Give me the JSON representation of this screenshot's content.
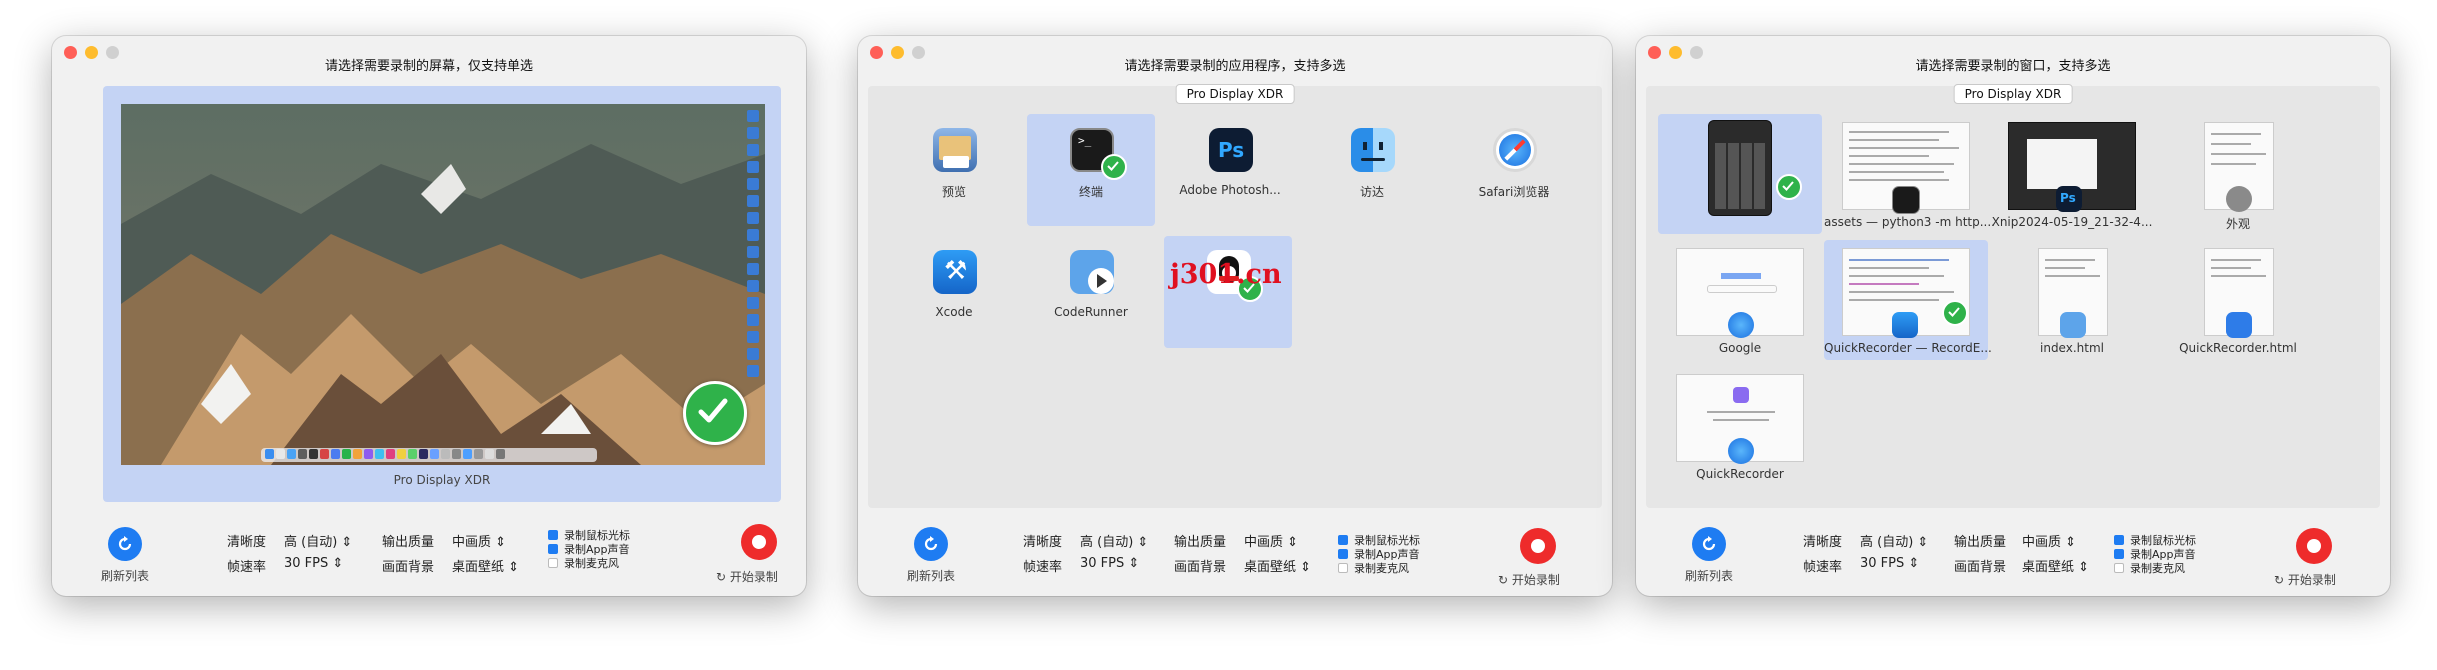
{
  "windows": [
    {
      "title": "请选择需要录制的屏幕，仅支持单选",
      "screen_label": "Pro Display XDR",
      "bottom": {
        "refresh_label": "刷新列表",
        "clarity_label": "清晰度",
        "clarity_value": "高 (自动)",
        "fps_label": "帧速率",
        "fps_value": "30 FPS",
        "quality_label": "输出质量",
        "quality_value": "中画质",
        "bg_label": "画面背景",
        "bg_value": "桌面壁纸",
        "cb1": "录制鼠标光标",
        "cb2": "录制App声音",
        "cb3": "录制麦克风",
        "record_label": "开始录制"
      }
    },
    {
      "title": "请选择需要录制的应用程序，支持多选",
      "display_chip": "Pro Display XDR",
      "apps": [
        {
          "label": "预览",
          "selected": false
        },
        {
          "label": "终端",
          "selected": true
        },
        {
          "label": "Adobe Photosh...",
          "selected": false
        },
        {
          "label": "访达",
          "selected": false
        },
        {
          "label": "Safari浏览器",
          "selected": false
        },
        {
          "label": "Xcode",
          "selected": false
        },
        {
          "label": "CodeRunner",
          "selected": false
        },
        {
          "label": "",
          "selected": true
        }
      ],
      "bottom": {
        "refresh_label": "刷新列表",
        "clarity_label": "清晰度",
        "clarity_value": "高 (自动)",
        "fps_label": "帧速率",
        "fps_value": "30 FPS",
        "quality_label": "输出质量",
        "quality_value": "中画质",
        "bg_label": "画面背景",
        "bg_value": "桌面壁纸",
        "cb1": "录制鼠标光标",
        "cb2": "录制App声音",
        "cb3": "录制麦克风",
        "record_label": "开始录制"
      }
    },
    {
      "title": "请选择需要录制的窗口，支持多选",
      "display_chip": "Pro Display XDR",
      "wins": [
        {
          "label": "",
          "selected": true
        },
        {
          "label": "assets — python3 -m http....",
          "selected": false
        },
        {
          "label": "Xnip2024-05-19_21-32-4...",
          "selected": false
        },
        {
          "label": "外观",
          "selected": false
        },
        {
          "label": "Google",
          "selected": false
        },
        {
          "label": "QuickRecorder — RecordE...",
          "selected": true
        },
        {
          "label": "index.html",
          "selected": false
        },
        {
          "label": "QuickRecorder.html",
          "selected": false
        },
        {
          "label": "QuickRecorder",
          "selected": false
        }
      ],
      "bottom": {
        "refresh_label": "刷新列表",
        "clarity_label": "清晰度",
        "clarity_value": "高 (自动)",
        "fps_label": "帧速率",
        "fps_value": "30 FPS",
        "quality_label": "输出质量",
        "quality_value": "中画质",
        "bg_label": "画面背景",
        "bg_value": "桌面壁纸",
        "cb1": "录制鼠标光标",
        "cb2": "录制App声音",
        "cb3": "录制麦克风",
        "record_label": "开始录制"
      }
    }
  ],
  "watermark": "j301.cn",
  "icons": {
    "refresh": "refresh-icon",
    "record": "record-icon",
    "check": "checkmark-icon",
    "updown": "chevron-updown-icon"
  },
  "colors": {
    "accent": "#1e7cf2",
    "selection": "#c4d3f4",
    "record": "#ee2b2b",
    "check": "#2fb24a"
  }
}
